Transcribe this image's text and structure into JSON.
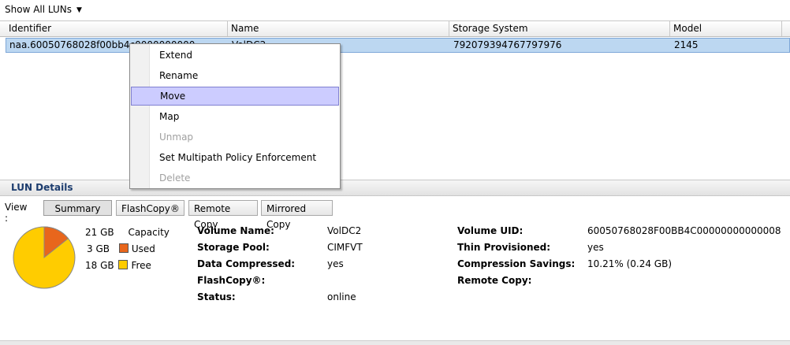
{
  "filter": {
    "label": "Show All LUNs"
  },
  "table": {
    "columns": [
      "Identifier",
      "Name",
      "Storage System",
      "Model"
    ],
    "row": {
      "identifier": "naa.60050768028f00bb4c0000000000",
      "name": "VolDC2",
      "storage_system": "792079394767797976",
      "model": "2145"
    }
  },
  "context_menu": {
    "items": [
      {
        "label": "Extend",
        "enabled": true
      },
      {
        "label": "Rename",
        "enabled": true
      },
      {
        "label": "Move",
        "enabled": true,
        "highlighted": true
      },
      {
        "label": "Map",
        "enabled": true
      },
      {
        "label": "Unmap",
        "enabled": false
      },
      {
        "label": "Set Multipath Policy Enforcement",
        "enabled": true
      },
      {
        "label": "Delete",
        "enabled": false
      }
    ]
  },
  "details": {
    "title": "LUN Details",
    "view_label": "View :",
    "tabs": [
      "Summary",
      "FlashCopy®",
      "Remote Copy",
      "Mirrored Copy"
    ],
    "active_tab": "Summary",
    "capacity": {
      "total": "21 GB",
      "total_label": "Capacity",
      "used": "3 GB",
      "used_label": "Used",
      "free": "18 GB",
      "free_label": "Free",
      "used_fraction": 0.143,
      "used_color": "#e8661c",
      "free_color": "#ffcc00"
    },
    "fields_left": [
      {
        "label": "Volume Name:",
        "value": "VolDC2"
      },
      {
        "label": "Storage Pool:",
        "value": "CIMFVT"
      },
      {
        "label": "Data Compressed:",
        "value": "yes"
      },
      {
        "label": "FlashCopy®:",
        "value": ""
      },
      {
        "label": "Status:",
        "value": "online"
      }
    ],
    "fields_right": [
      {
        "label": "Volume UID:",
        "value": "60050768028F00BB4C00000000000008"
      },
      {
        "label": "Thin Provisioned:",
        "value": "yes"
      },
      {
        "label": "Compression Savings:",
        "value": "10.21% (0.24 GB)"
      },
      {
        "label": "Remote Copy:",
        "value": ""
      }
    ]
  }
}
